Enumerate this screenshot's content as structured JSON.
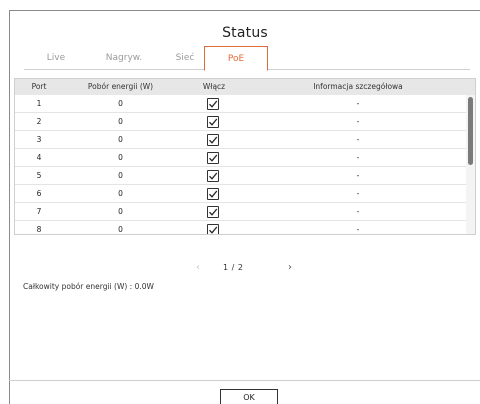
{
  "dialog": {
    "title": "Status"
  },
  "tabs": [
    {
      "label": "Live",
      "active": false
    },
    {
      "label": "Nagryw.",
      "active": false
    },
    {
      "label": "Sieć",
      "active": false
    },
    {
      "label": "PoE",
      "active": true
    }
  ],
  "table": {
    "headers": {
      "port": "Port",
      "power": "Pobór energii (W)",
      "enable": "Włącz",
      "info": "Informacja szczegółowa"
    },
    "rows": [
      {
        "port": "1",
        "power": "0",
        "enabled": true,
        "info": "-"
      },
      {
        "port": "2",
        "power": "0",
        "enabled": true,
        "info": "-"
      },
      {
        "port": "3",
        "power": "0",
        "enabled": true,
        "info": "-"
      },
      {
        "port": "4",
        "power": "0",
        "enabled": true,
        "info": "-"
      },
      {
        "port": "5",
        "power": "0",
        "enabled": true,
        "info": "-"
      },
      {
        "port": "6",
        "power": "0",
        "enabled": true,
        "info": "-"
      },
      {
        "port": "7",
        "power": "0",
        "enabled": true,
        "info": "-"
      },
      {
        "port": "8",
        "power": "0",
        "enabled": true,
        "info": "-"
      }
    ]
  },
  "pager": {
    "prev": "‹",
    "text": "1 / 2",
    "next": "›"
  },
  "total": "Całkowity pobór energii (W) : 0.0W",
  "buttons": {
    "ok": "OK"
  },
  "colors": {
    "accent": "#e06b3a",
    "header_bg": "#e7e7e7",
    "scroll_thumb": "#7a7a7a"
  }
}
